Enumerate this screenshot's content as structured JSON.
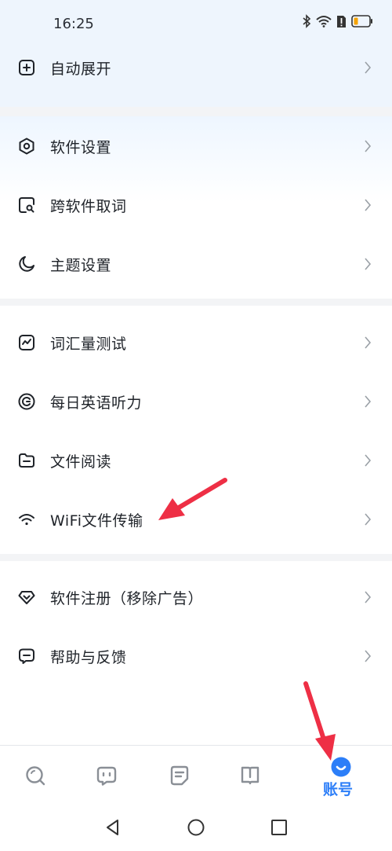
{
  "status_bar": {
    "time": "16:25"
  },
  "menu": {
    "section0": [
      {
        "label": "自动展开",
        "icon": "plus-square-icon"
      }
    ],
    "section1": [
      {
        "label": "软件设置",
        "icon": "hexagon-settings-icon"
      },
      {
        "label": "跨软件取词",
        "icon": "search-square-icon"
      },
      {
        "label": "主题设置",
        "icon": "moon-icon"
      }
    ],
    "section2": [
      {
        "label": "词汇量测试",
        "icon": "chart-icon"
      },
      {
        "label": "每日英语听力",
        "icon": "headphone-circle-icon"
      },
      {
        "label": "文件阅读",
        "icon": "folder-icon"
      },
      {
        "label": "WiFi文件传输",
        "icon": "wifi-icon"
      }
    ],
    "section3": [
      {
        "label": "软件注册（移除广告）",
        "icon": "diamond-icon"
      },
      {
        "label": "帮助与反馈",
        "icon": "message-icon"
      }
    ]
  },
  "tabbar": {
    "tabs": [
      {
        "name": "search-tab",
        "icon": "search-icon"
      },
      {
        "name": "chat-tab",
        "icon": "chat-icon"
      },
      {
        "name": "notes-tab",
        "icon": "note-icon"
      },
      {
        "name": "book-tab",
        "icon": "book-icon"
      }
    ],
    "account_label": "账号"
  },
  "colors": {
    "accent": "#2c7ef8",
    "annotation": "#ee2f45"
  }
}
